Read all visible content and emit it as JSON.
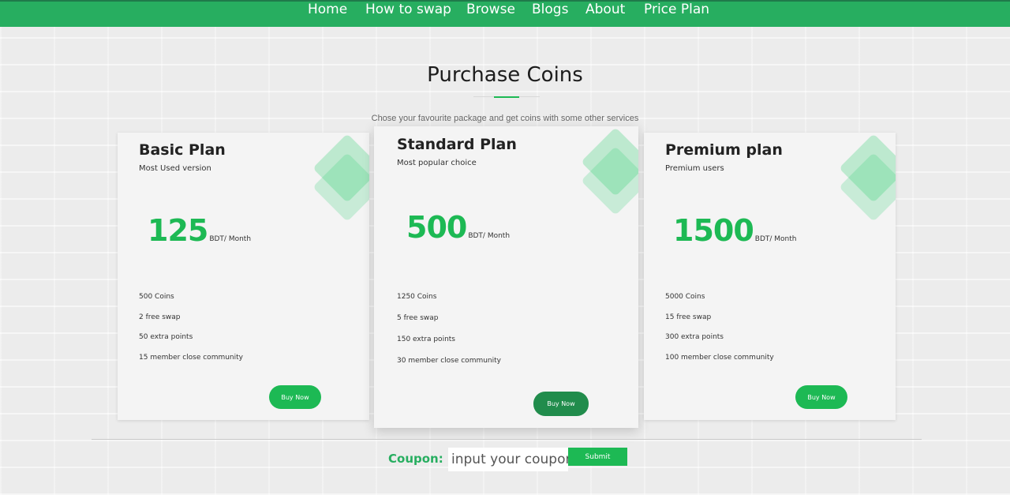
{
  "nav": {
    "items": [
      "Home",
      "How to swap",
      "Browse",
      "Blogs",
      "About",
      "Price Plan"
    ]
  },
  "header": {
    "title": "Purchase Coins",
    "subtitle": "Chose your favourite package and get coins with some other services"
  },
  "plans": [
    {
      "name": "Basic Plan",
      "tagline": "Most Used version",
      "price": "125",
      "unit": "BDT/ Month",
      "features": [
        "500 Coins",
        "2 free swap",
        "50 extra points",
        "15 member close community"
      ],
      "button": "Buy Now"
    },
    {
      "name": "Standard Plan",
      "tagline": "Most popular choice",
      "price": "500",
      "unit": "BDT/ Month",
      "features": [
        "1250 Coins",
        "5 free swap",
        "150 extra points",
        "30 member close community"
      ],
      "button": "Buy Now"
    },
    {
      "name": "Premium plan",
      "tagline": "Premium users",
      "price": "1500",
      "unit": "BDT/ Month",
      "features": [
        "5000 Coins",
        "15 free swap",
        "300 extra points",
        "100 member close community"
      ],
      "button": "Buy Now"
    }
  ],
  "coupon": {
    "label": "Coupon:",
    "placeholder": "input your coupon",
    "submit": "Submit"
  },
  "colors": {
    "brand_green": "#27ae60",
    "accent_green": "#1db954",
    "active_button": "#218c4c"
  }
}
